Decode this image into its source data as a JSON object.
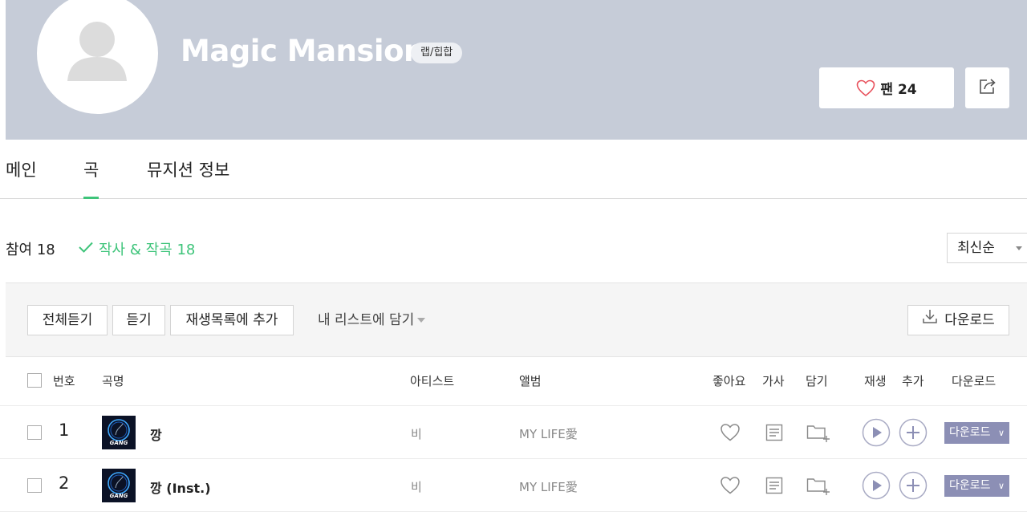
{
  "header": {
    "artist_name": "Magic Mansion",
    "genre": "랩/힙합",
    "fan_label": "팬 24",
    "heart_icon_color": "#e8505b",
    "background": "#c6ccd8"
  },
  "tabs": [
    {
      "label": "메인",
      "active": false
    },
    {
      "label": "곡",
      "active": true
    },
    {
      "label": "뮤지션 정보",
      "active": false
    }
  ],
  "filter": {
    "count_label": "참여 18",
    "active_filter": "작사 & 작곡 18",
    "accent_color": "#3ec47a",
    "sort": "최신순"
  },
  "toolbar": {
    "play_all": "전체듣기",
    "play": "듣기",
    "add_playlist": "재생목록에 추가",
    "my_list": "내 리스트에 담기",
    "download": "다운로드"
  },
  "table": {
    "columns": {
      "number": "번호",
      "title": "곡명",
      "artist": "아티스트",
      "album": "앨범",
      "like": "좋아요",
      "lyrics": "가사",
      "save": "담기",
      "play": "재생",
      "add": "추가",
      "download": "다운로드"
    },
    "rows": [
      {
        "number": "1",
        "title": "깡",
        "artist": "비",
        "album": "MY LIFE愛",
        "download": "다운로드",
        "thumb_text": "GANG"
      },
      {
        "number": "2",
        "title": "깡 (Inst.)",
        "artist": "비",
        "album": "MY LIFE愛",
        "download": "다운로드",
        "thumb_text": "GANG"
      }
    ]
  }
}
